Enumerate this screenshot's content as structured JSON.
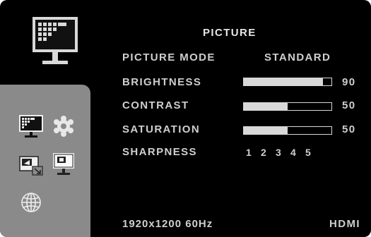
{
  "menu": {
    "title": "PICTURE",
    "picture_mode": {
      "label": "PICTURE MODE",
      "value": "STANDARD"
    },
    "settings": [
      {
        "label": "BRIGHTNESS",
        "value": "90",
        "level": 0.9
      },
      {
        "label": "CONTRAST",
        "value": "50",
        "level": 0.5
      },
      {
        "label": "SATURATION",
        "value": "50",
        "level": 0.5
      }
    ],
    "sharpness": {
      "label": "SHARPNESS",
      "options": [
        "1",
        "2",
        "3",
        "4",
        "5"
      ]
    }
  },
  "status": {
    "resolution": "1920x1200 60Hz",
    "input": "HDMI"
  },
  "sidebar": {
    "items": [
      {
        "icon": "monitor-picture-icon",
        "state": "selected"
      },
      {
        "icon": "gear-icon",
        "state": "normal"
      },
      {
        "icon": "input-source-icon",
        "state": "normal"
      },
      {
        "icon": "monitor-position-icon",
        "state": "normal"
      },
      {
        "icon": "globe-icon",
        "state": "normal"
      }
    ]
  },
  "colors": {
    "background": "#000000",
    "sidebar": "#8a8a8a",
    "text": "#cfcfcf",
    "bar": "#d8d8d8"
  }
}
